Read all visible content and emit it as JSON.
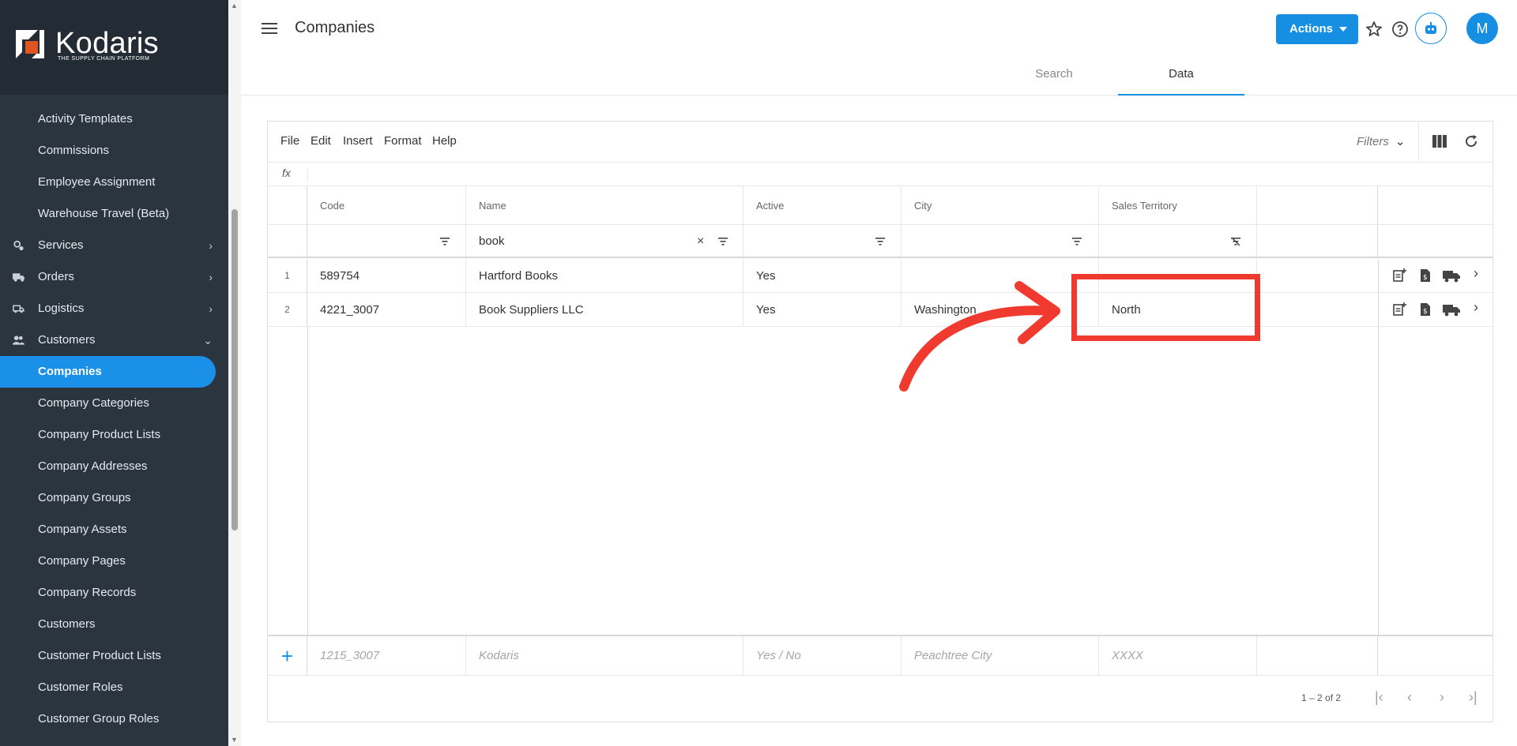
{
  "brand": {
    "name": "Kodaris",
    "tagline": "THE SUPPLY CHAIN PLATFORM"
  },
  "sidebar": {
    "items": [
      {
        "label": "Activity Templates"
      },
      {
        "label": "Commissions"
      },
      {
        "label": "Employee Assignment"
      },
      {
        "label": "Warehouse Travel (Beta)"
      },
      {
        "label": "Services",
        "icon": "services-icon"
      },
      {
        "label": "Orders",
        "icon": "truck-icon"
      },
      {
        "label": "Logistics",
        "icon": "delivery-icon"
      },
      {
        "label": "Customers",
        "icon": "people-icon"
      },
      {
        "label": "Companies",
        "active": true
      },
      {
        "label": "Company Categories"
      },
      {
        "label": "Company Product Lists"
      },
      {
        "label": "Company Addresses"
      },
      {
        "label": "Company Groups"
      },
      {
        "label": "Company Assets"
      },
      {
        "label": "Company Pages"
      },
      {
        "label": "Company Records"
      },
      {
        "label": "Customers"
      },
      {
        "label": "Customer Product Lists"
      },
      {
        "label": "Customer Roles"
      },
      {
        "label": "Customer Group Roles"
      }
    ]
  },
  "header": {
    "title": "Companies",
    "actions_label": "Actions",
    "avatar_initial": "M",
    "tabs": [
      {
        "label": "Search"
      },
      {
        "label": "Data",
        "active": true
      }
    ]
  },
  "toolbar": {
    "menus": [
      "File",
      "Edit",
      "Insert",
      "Format",
      "Help"
    ],
    "filters_label": "Filters",
    "fx_label": "fx"
  },
  "grid": {
    "columns": [
      "Code",
      "Name",
      "Active",
      "City",
      "Sales Territory"
    ],
    "filter_values": [
      "",
      "book",
      "",
      "",
      ""
    ],
    "rows": [
      {
        "num": "1",
        "cells": [
          "589754",
          "Hartford Books",
          "Yes",
          "",
          ""
        ]
      },
      {
        "num": "2",
        "cells": [
          "4221_3007",
          "Book Suppliers LLC",
          "Yes",
          "Washington",
          "North"
        ]
      }
    ],
    "new_row_placeholders": [
      "1215_3007",
      "Kodaris",
      "Yes / No",
      "Peachtree City",
      "XXXX"
    ],
    "page_info": "1 – 2 of 2"
  },
  "colors": {
    "accent": "#168fe2",
    "sidebar": "#2b3540",
    "annotation": "#f03a2f"
  }
}
